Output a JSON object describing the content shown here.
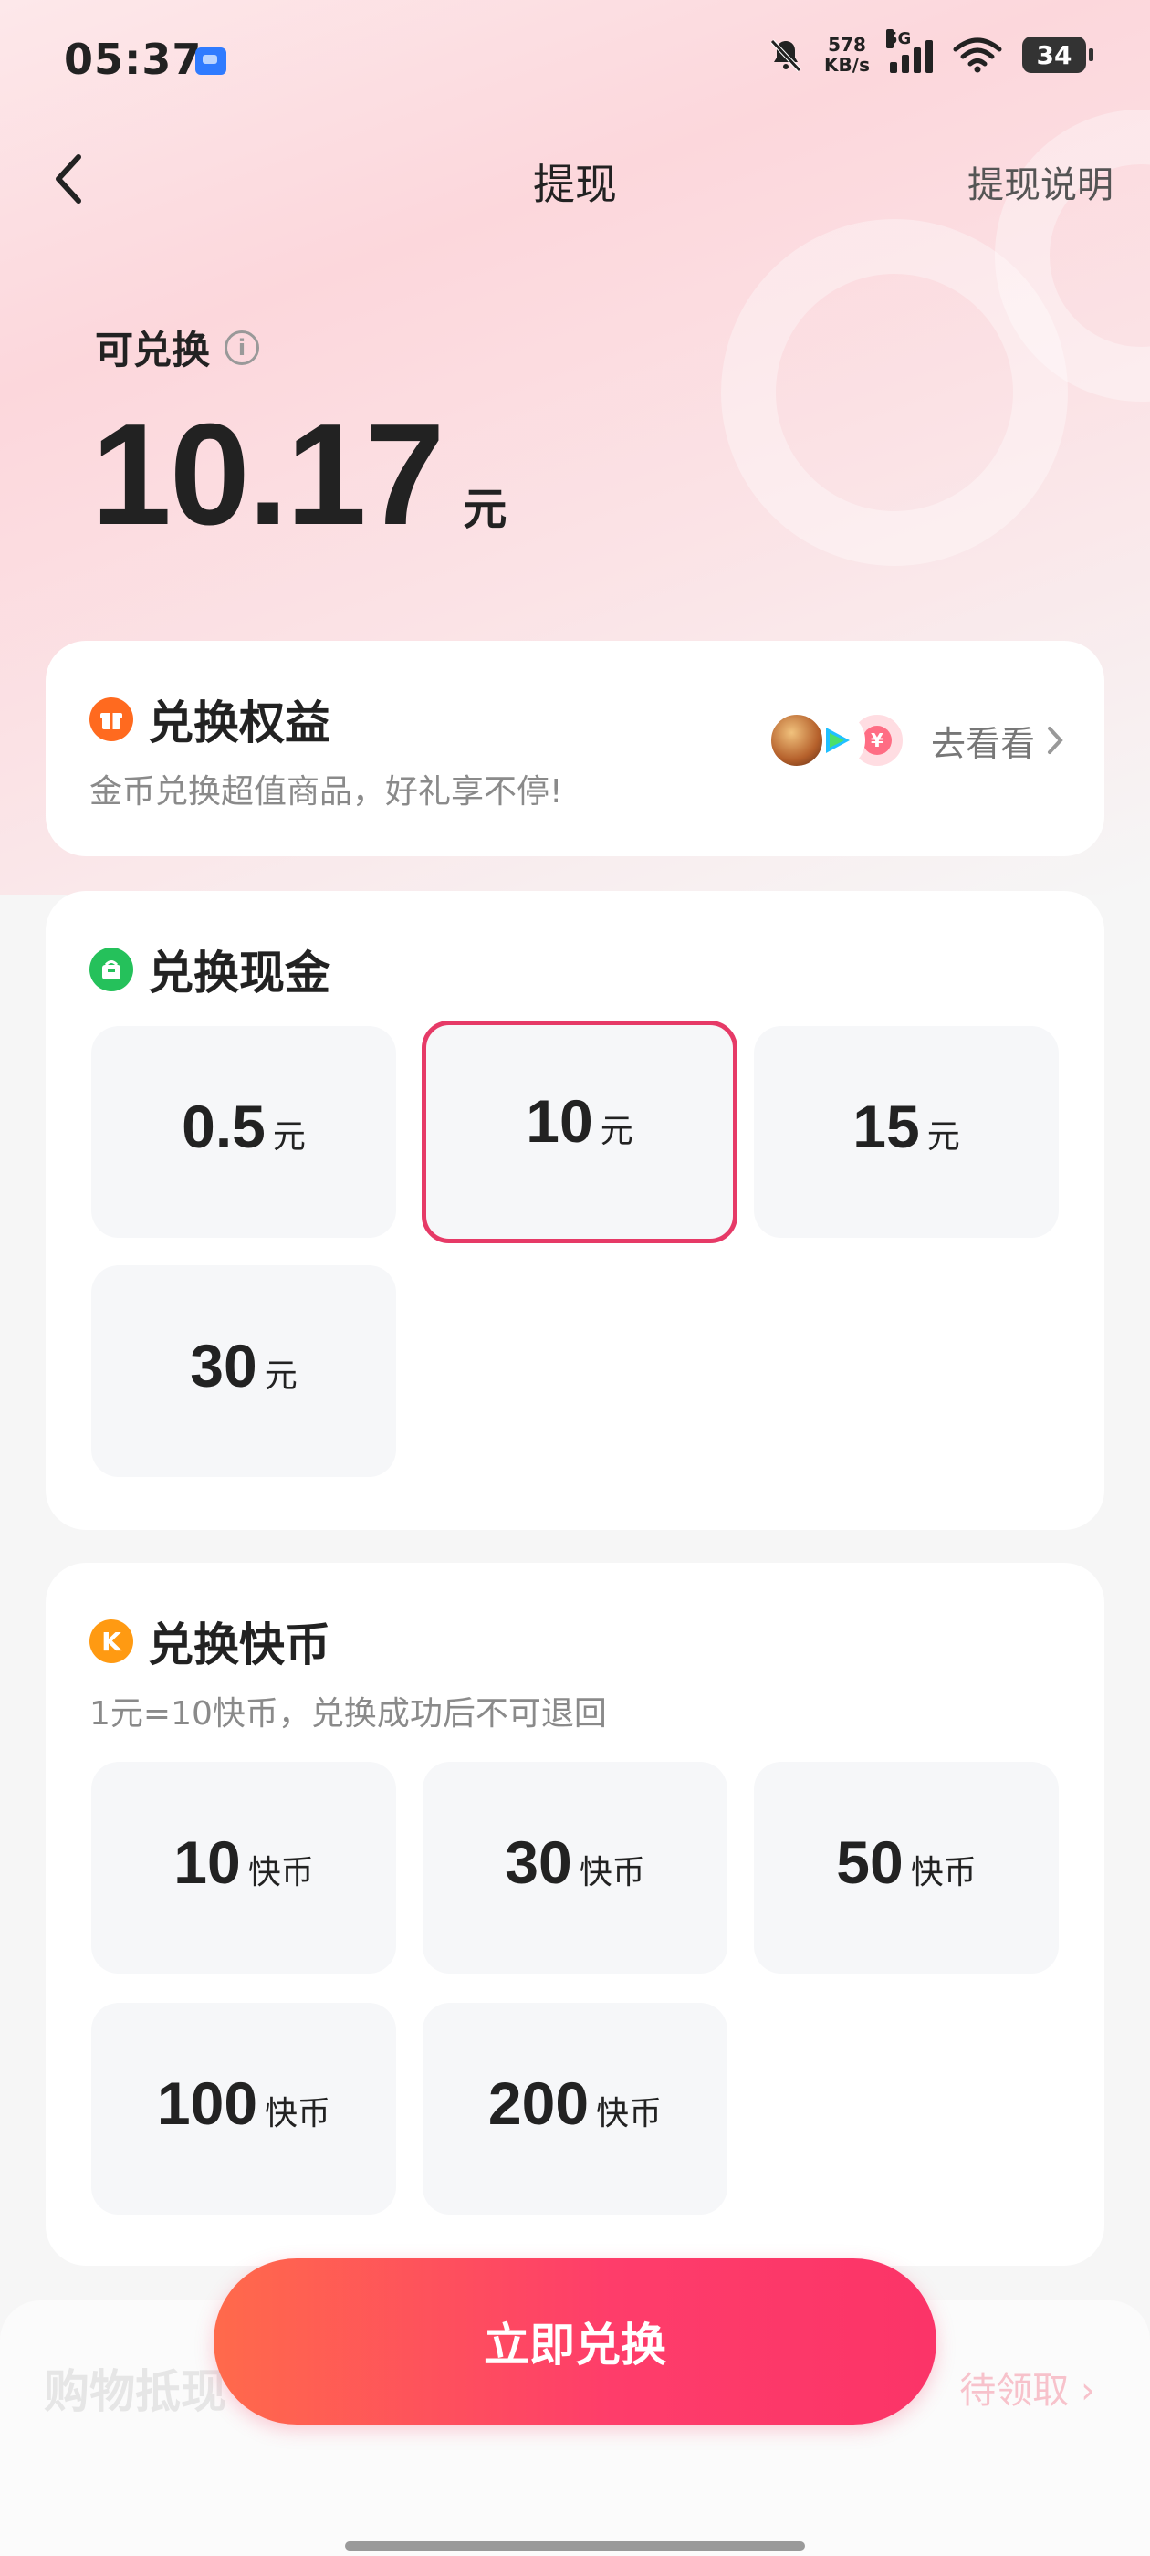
{
  "status_bar": {
    "time": "05:37",
    "net_speed_value": "578",
    "net_speed_unit": "KB/s",
    "network_type": "5G",
    "battery": "34"
  },
  "nav": {
    "title": "提现",
    "help": "提现说明"
  },
  "balance": {
    "label": "可兑换",
    "info_icon": "i",
    "amount": "10.17",
    "unit": "元"
  },
  "rights_card": {
    "title": "兑换权益",
    "subtitle": "金币兑换超值商品，好礼享不停!",
    "link": "去看看",
    "badge_glyph": "¥",
    "icon_color": "#ff6a1f"
  },
  "cash_card": {
    "title": "兑换现金",
    "icon_color": "#25c15b",
    "options": [
      {
        "value": "0.5",
        "unit": "元"
      },
      {
        "value": "10",
        "unit": "元"
      },
      {
        "value": "15",
        "unit": "元"
      },
      {
        "value": "30",
        "unit": "元"
      }
    ]
  },
  "coin_card": {
    "title": "兑换快币",
    "icon_letter": "K",
    "icon_color": "#ff9a12",
    "subtitle": "1元=10快币，兑换成功后不可退回",
    "options": [
      {
        "value": "10",
        "unit": "快币"
      },
      {
        "value": "30",
        "unit": "快币"
      },
      {
        "value": "50",
        "unit": "快币"
      },
      {
        "value": "100",
        "unit": "快币"
      },
      {
        "value": "200",
        "unit": "快币"
      }
    ]
  },
  "shopping": {
    "title": "购物抵现",
    "pending": "待领取"
  },
  "cta": {
    "label": "立即兑换"
  },
  "colors": {
    "accent": "#fe3d6a",
    "selected_border": "#e63a67"
  }
}
